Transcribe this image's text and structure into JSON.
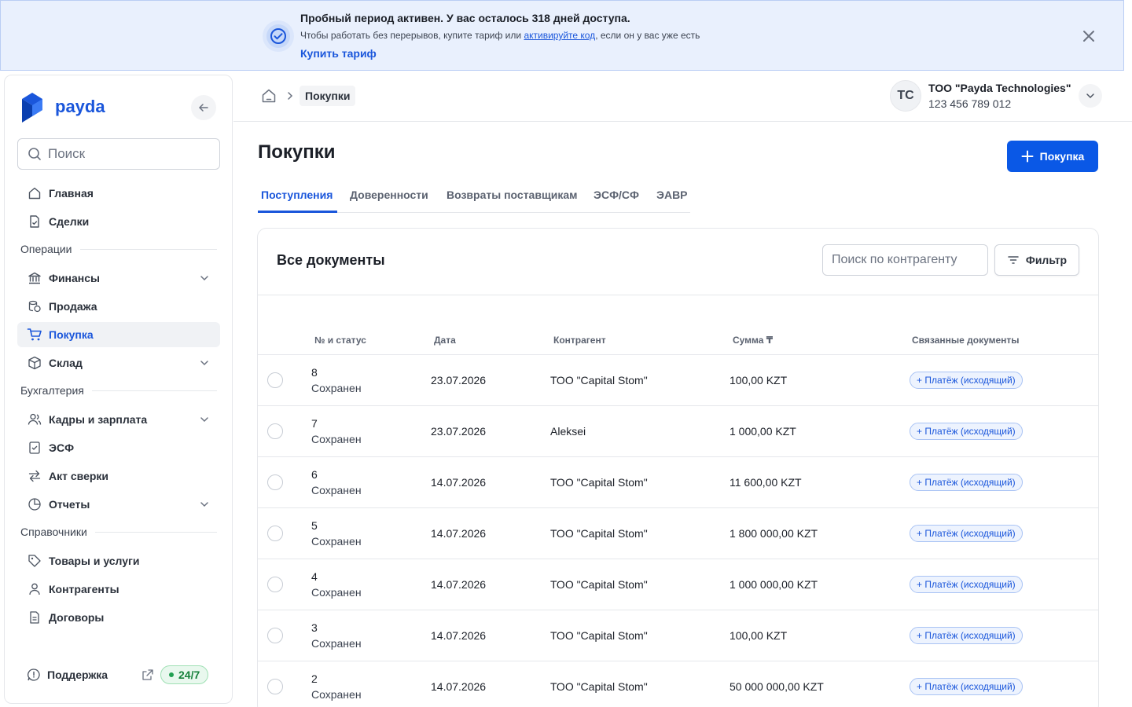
{
  "banner": {
    "title": "Пробный период активен. У вас осталось 318 дней доступа.",
    "subtitle_before": "Чтобы работать без перерывов, купите тариф или ",
    "subtitle_link": "активируйте код",
    "subtitle_after": ", если он у вас уже есть",
    "cta": "Купить тариф"
  },
  "sidebar": {
    "brand": "payda",
    "search_placeholder": "Поиск",
    "items": [
      {
        "label": "Главная"
      },
      {
        "label": "Сделки"
      },
      {
        "label": "Операции"
      },
      {
        "label": "Финансы"
      },
      {
        "label": "Продажа"
      },
      {
        "label": "Покупка"
      },
      {
        "label": "Склад"
      },
      {
        "label": "Бухгалтерия"
      },
      {
        "label": "Кадры и зарплата"
      },
      {
        "label": "ЭСФ"
      },
      {
        "label": "Акт сверки"
      },
      {
        "label": "Отчеты"
      },
      {
        "label": "Справочники"
      },
      {
        "label": "Товары и услуги"
      },
      {
        "label": "Контрагенты"
      },
      {
        "label": "Договоры"
      }
    ],
    "support": {
      "label": "Поддержка",
      "badge": "24/7"
    }
  },
  "header": {
    "breadcrumb": "Покупки",
    "avatar_initials": "TC",
    "org_name": "ТОО \"Payda Technologies\"",
    "org_bin": "123 456 789 012"
  },
  "main": {
    "title": "Покупки",
    "add_button": "Покупка",
    "tabs": [
      {
        "label": "Поступления"
      },
      {
        "label": "Доверенности"
      },
      {
        "label": "Возвраты поставщикам"
      },
      {
        "label": "ЭСФ/СФ"
      },
      {
        "label": "ЭАВР"
      }
    ],
    "card_title": "Все документы",
    "search_placeholder": "Поиск по контрагенту",
    "filter_button": "Фильтр",
    "columns": [
      "№ и статус",
      "Дата",
      "Контрагент",
      "Сумма ₸",
      "Связанные документы"
    ],
    "rows": [
      {
        "num": "8",
        "status": "Сохранен",
        "date": "23.07.2026",
        "counterparty": "ТОО \"Capital Stom\"",
        "amount": "100,00 KZT",
        "related": "+ Платёж (исходящий)"
      },
      {
        "num": "7",
        "status": "Сохранен",
        "date": "23.07.2026",
        "counterparty": "Aleksei",
        "amount": "1 000,00 KZT",
        "related": "+ Платёж (исходящий)"
      },
      {
        "num": "6",
        "status": "Сохранен",
        "date": "14.07.2026",
        "counterparty": "ТОО \"Capital Stom\"",
        "amount": "11 600,00 KZT",
        "related": "+ Платёж (исходящий)"
      },
      {
        "num": "5",
        "status": "Сохранен",
        "date": "14.07.2026",
        "counterparty": "ТОО \"Capital Stom\"",
        "amount": "1 800 000,00 KZT",
        "related": "+ Платёж (исходящий)"
      },
      {
        "num": "4",
        "status": "Сохранен",
        "date": "14.07.2026",
        "counterparty": "ТОО \"Capital Stom\"",
        "amount": "1 000 000,00 KZT",
        "related": "+ Платёж (исходящий)"
      },
      {
        "num": "3",
        "status": "Сохранен",
        "date": "14.07.2026",
        "counterparty": "ТОО \"Capital Stom\"",
        "amount": "100,00 KZT",
        "related": "+ Платёж (исходящий)"
      },
      {
        "num": "2",
        "status": "Сохранен",
        "date": "14.07.2026",
        "counterparty": "ТОО \"Capital Stom\"",
        "amount": "50 000 000,00 KZT",
        "related": "+ Платёж (исходящий)"
      }
    ]
  }
}
